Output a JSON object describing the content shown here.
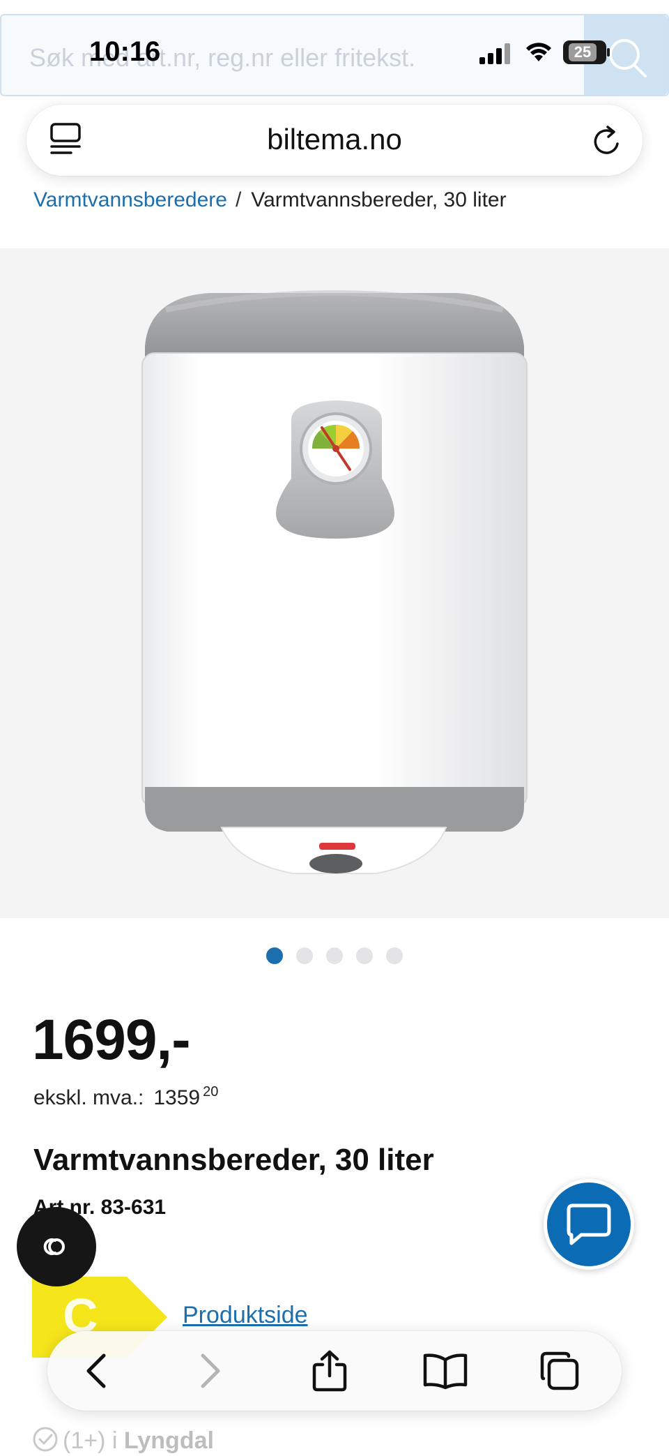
{
  "status_bar": {
    "time": "10:16",
    "battery": "25"
  },
  "search": {
    "placeholder": "Søk med art.nr, reg.nr eller fritekst."
  },
  "browser": {
    "domain": "biltema.no"
  },
  "breadcrumb": {
    "parent": "Varmtvannsberedere",
    "separator": "/",
    "current": "Varmtvannsbereder, 30 liter"
  },
  "carousel": {
    "total": 5,
    "active_index": 1
  },
  "product": {
    "price": "1699,-",
    "ex_vat_label": "ekskl. mva.:",
    "ex_vat_value": "1359",
    "ex_vat_decimals": "20",
    "title": "Varmtvannsbereder, 30 liter",
    "art_nr": "Art.nr. 83-631",
    "energy_class": "C",
    "product_page_link": "Produktside"
  },
  "stock": {
    "count": "(1+) i",
    "store": "Lyngdal"
  },
  "colors": {
    "accent": "#1b6fae",
    "chat_button": "#0b6cb5",
    "energy_label": "#f5e61b"
  },
  "icons": {
    "toolbar": [
      "back-icon",
      "forward-icon",
      "share-icon",
      "bookmarks-icon",
      "tabs-icon"
    ],
    "floating": [
      "co-icon",
      "chat-icon"
    ]
  }
}
